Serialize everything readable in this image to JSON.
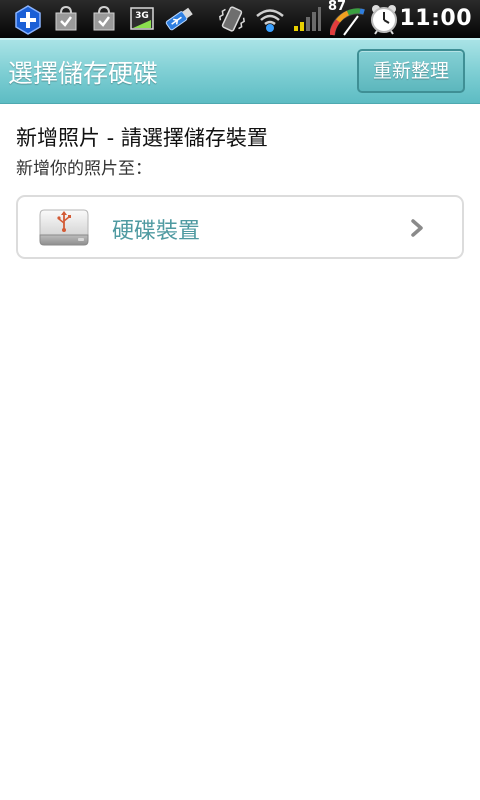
{
  "status_bar": {
    "time": "11:00",
    "battery_level": "87",
    "network_type": "3G",
    "icons": [
      "add-icon",
      "shopping-bag-icon",
      "shopping-bag-icon",
      "network-3g-icon",
      "usb-icon",
      "vibrate-icon",
      "wifi-icon",
      "signal-icon",
      "battery-gauge-icon",
      "alarm-clock-icon"
    ]
  },
  "title_bar": {
    "title": "選擇儲存硬碟",
    "refresh_label": "重新整理"
  },
  "main": {
    "heading": "新增照片 - 請選擇儲存裝置",
    "subheading": "新增你的照片至：",
    "devices": [
      {
        "label": "硬碟裝置",
        "icon": "hard-drive-icon"
      }
    ]
  },
  "colors": {
    "title_bar": "#7fcfd4",
    "accent_text": "#4f9aa1",
    "status_bar": "#111111"
  }
}
